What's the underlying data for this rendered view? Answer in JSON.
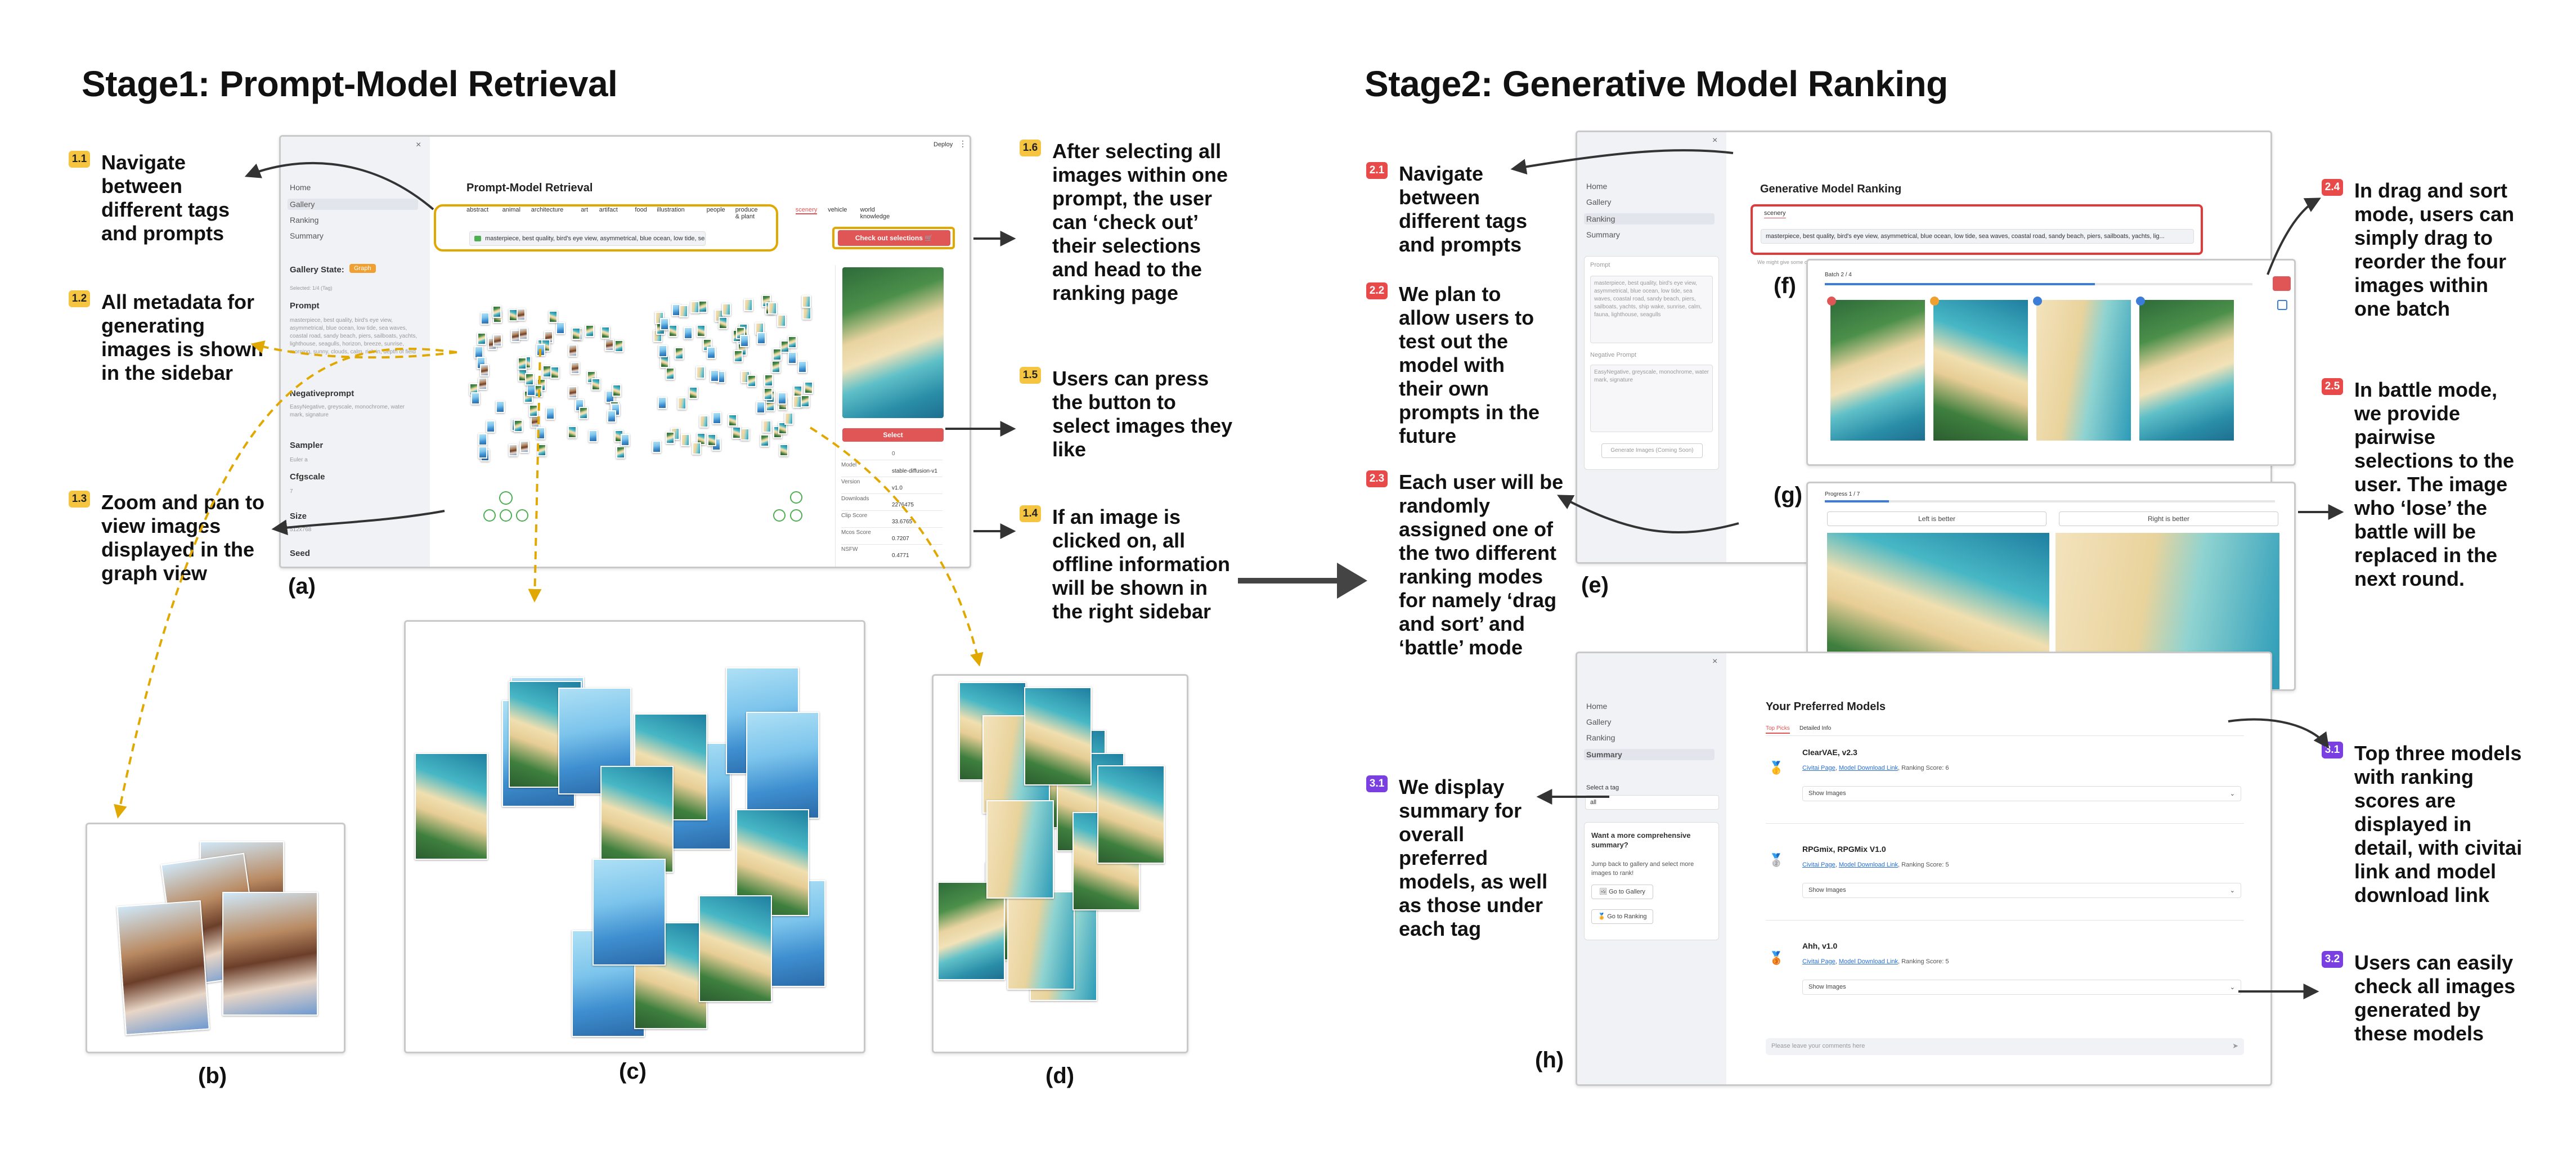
{
  "stage1": {
    "title": "Stage1: Prompt-Model Retrieval"
  },
  "stage2": {
    "title": "Stage2:  Generative Model Ranking"
  },
  "panel_labels": {
    "a": "(a)",
    "b": "(b)",
    "c": "(c)",
    "d": "(d)",
    "e": "(e)",
    "f": "(f)",
    "g": "(g)",
    "h": "(h)"
  },
  "annotations_stage1": [
    {
      "id": "1.1",
      "text": "Navigate between different tags and prompts"
    },
    {
      "id": "1.2",
      "text": "All metadata for generating images is shown in the sidebar"
    },
    {
      "id": "1.3",
      "text": "Zoom and pan to view images displayed in the graph view"
    },
    {
      "id": "1.6",
      "text": "After selecting all images within one prompt, the user can ‘check out’ their selections and head to the ranking page"
    },
    {
      "id": "1.5",
      "text": "Users can press the button to select images they like"
    },
    {
      "id": "1.4",
      "text": "If an image is clicked on, all offline information will be shown in the right sidebar"
    }
  ],
  "annotations_stage2": [
    {
      "id": "2.1",
      "text": "Navigate between different tags and prompts"
    },
    {
      "id": "2.2",
      "text": "We plan to allow users to test out the model with their own prompts in the future"
    },
    {
      "id": "2.3",
      "text": "Each user will be randomly assigned one of the two different ranking modes for  namely ‘drag and sort’ and ‘battle’ mode"
    },
    {
      "id": "3.1",
      "text": "We display summary for overall preferred models, as well as those under each tag"
    },
    {
      "id": "2.4",
      "text": "In drag and sort mode, users can simply drag to reorder the four images within one batch"
    },
    {
      "id": "2.5",
      "text": "In battle mode, we provide pairwise selections to the user. The image who ‘lose’ the battle will be replaced in the next round."
    },
    {
      "id": "3.1",
      "text": "Top three models with ranking scores are displayed in detail, with civitai link and model download link"
    },
    {
      "id": "3.2",
      "text": "Users can easily check all images generated by these models"
    }
  ],
  "app_a": {
    "close": "×",
    "deploy": "Deploy",
    "menu": "⋮",
    "nav": [
      "Home",
      "Gallery",
      "Ranking",
      "Summary"
    ],
    "gallery_state_label": "Gallery State:",
    "gallery_state_badge": "Graph",
    "sidebar_small": "Selected: 1/4 (Tag)",
    "prompt_label": "Prompt",
    "prompt_text": "masterpiece, best quality, bird's eye view, asymmetrical, blue ocean, low tide, sea waves, coastal road, sandy beach, piers, sailboats, yachts, lighthouse, seagulls, horizon, breeze, sunrise, morning, sunny, clouds, calm, rich in, depth of field",
    "negprompt_label": "Negativeprompt",
    "negprompt_text": "EasyNegative, greyscale, monochrome, water mark, signature",
    "sampler_label": "Sampler",
    "sampler_value": "Euler a",
    "cfg_label": "Cfgscale",
    "cfg_value": "7",
    "size_label": "Size",
    "size_value": "512x768",
    "seed_label": "Seed",
    "title": "Prompt-Model Retrieval",
    "tags": [
      "abstract",
      "animal",
      "architecture",
      "art",
      "artifact",
      "food",
      "illustration",
      "people",
      "produce & plant",
      "scenery",
      "vehicle",
      "world knowledge"
    ],
    "selected_tag": "scenery",
    "prompt_select": "masterpiece, best quality, bird's eye view, asymmetrical, blue ocean, low tide, sea waves, coastal ro...",
    "checkout": "Check out selections 🛒",
    "select_btn": "Select",
    "metric_index": "0",
    "metrics": [
      {
        "k": "Model",
        "v": "stable-diffusion-v1"
      },
      {
        "k": "Version",
        "v": "v1.0"
      },
      {
        "k": "Downloads",
        "v": "2276475"
      },
      {
        "k": "Clip Score",
        "v": "33.6765"
      },
      {
        "k": "Mcos Score",
        "v": "0.7207"
      },
      {
        "k": "NSFW",
        "v": "0.4771"
      }
    ]
  },
  "app_e": {
    "close": "×",
    "nav": [
      "Home",
      "Gallery",
      "Ranking",
      "Summary"
    ],
    "title": "Generative Model Ranking",
    "tag_value": "scenery",
    "prompt_select": "masterpiece, best quality, bird's eye view, asymmetrical, blue ocean, low tide, sea waves, coastal road, sandy beach, piers, sailboats, yachts, lig...",
    "hint": "We might give some other images that you haven't selected based on our evaluation criteria.",
    "prompt_label": "Prompt",
    "prompt_text": "masterpiece, best quality, bird's eye view, asymmetrical, blue ocean, low tide, sea waves, coastal road, sandy beach, piers, sailboats, yachts, ship wake, sunrise, calm, fauna, lighthouse, seagulls",
    "neg_label": "Negative Prompt",
    "neg_text": "EasyNegative, greyscale, monochrome, water mark, signature",
    "generate_btn": "Generate Images (Coming Soon)",
    "batch_label": "Batch 2 / 4",
    "progress_label": "Progress 1 / 7",
    "left_better": "Left is better",
    "right_better": "Right is better"
  },
  "app_h": {
    "close": "×",
    "nav": [
      "Home",
      "Gallery",
      "Ranking",
      "Summary"
    ],
    "select_tag_label": "Select a tag",
    "select_tag_value": "all",
    "promo_title": "Want a more comprehensive summary?",
    "promo_text": "Jump back to gallery and select more images to rank!",
    "go_gallery": "🖼 Go to Gallery",
    "go_ranking": "🏅 Go to Ranking",
    "title": "Your Preferred Models",
    "tabs": [
      "Top Picks",
      "Detailed Info"
    ],
    "models": [
      {
        "name": "ClearVAE, v2.3",
        "civitai": "Civitai Page",
        "download": "Model Download Link",
        "score": ", Ranking Score: 6",
        "show": "Show Images",
        "medal": "🥇"
      },
      {
        "name": "RPGmix, RPGMix V1.0",
        "civitai": "Civitai Page",
        "download": "Model Download Link",
        "score": ", Ranking Score: 5",
        "show": "Show Images",
        "medal": "🥈"
      },
      {
        "name": "Ahh, v1.0",
        "civitai": "Civitai Page",
        "download": "Model Download Link",
        "score": ", Ranking Score: 5",
        "show": "Show Images",
        "medal": "🥉"
      }
    ],
    "comment_placeholder": "Please leave your comments here"
  },
  "colors": {
    "badge_yellow": "#f5c542",
    "badge_red": "#e84a4a",
    "badge_purple": "#7a3fe0",
    "highlight_yellow": "#e0a800",
    "highlight_red": "#e23a3a",
    "button_red": "#e05555"
  }
}
